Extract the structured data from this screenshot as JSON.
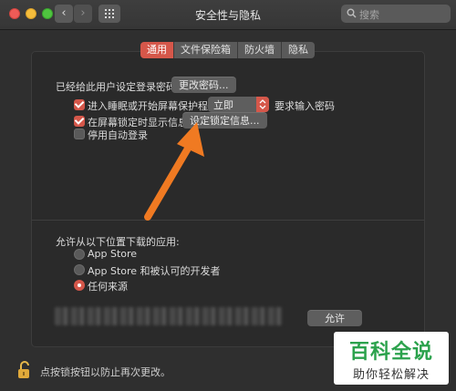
{
  "window": {
    "title": "安全性与隐私"
  },
  "toolbar": {
    "back_glyph": "‹",
    "forward_glyph": "›",
    "search_placeholder": "搜索"
  },
  "tabs": [
    {
      "label": "通用",
      "active": true
    },
    {
      "label": "文件保险箱",
      "active": false
    },
    {
      "label": "防火墙",
      "active": false
    },
    {
      "label": "隐私",
      "active": false
    }
  ],
  "general": {
    "password_set_text": "已经给此用户设定登录密码",
    "change_password_button": "更改密码...",
    "require_password": {
      "label": "进入睡眠或开始屏幕保护程序",
      "checked": true
    },
    "require_delay": "立即",
    "require_suffix": "要求输入密码",
    "show_message": {
      "label": "在屏幕锁定时显示信息",
      "checked": true
    },
    "set_lock_message_button": "设定锁定信息...",
    "disable_autologin": {
      "label": "停用自动登录",
      "checked": false
    }
  },
  "downloads": {
    "heading": "允许从以下位置下载的应用:",
    "options": [
      {
        "label": "App Store",
        "selected": false
      },
      {
        "label": "App Store 和被认可的开发者",
        "selected": false
      },
      {
        "label": "任何来源",
        "selected": true
      }
    ],
    "allow_button": "允许"
  },
  "footer": {
    "lock_text": "点按锁按钮以防止再次更改。"
  },
  "watermark": {
    "title": "百科全说",
    "subtitle": "助你轻松解决"
  },
  "colors": {
    "accent": "#d5574a",
    "annotation_arrow": "#f07a22",
    "watermark_green": "#2ba24c"
  },
  "icons": {
    "search": "search-icon",
    "grid": "grid-icon",
    "lock": "unlocked-padlock-icon"
  }
}
